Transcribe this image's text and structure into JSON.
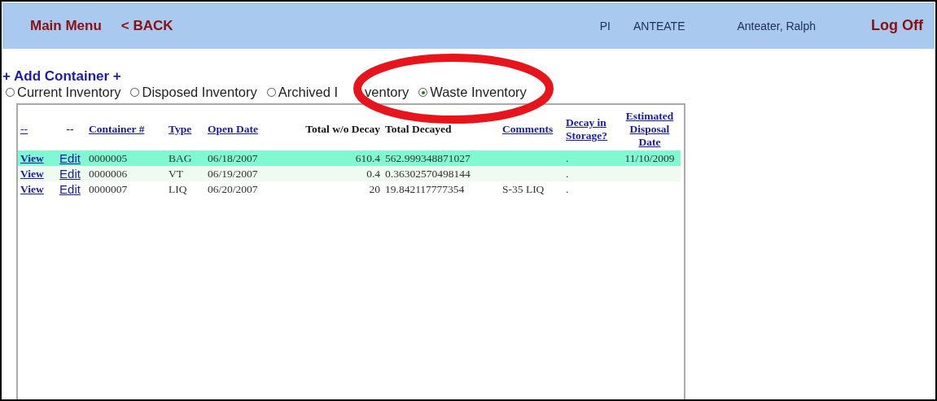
{
  "header": {
    "main_menu": "Main Menu",
    "back": "< BACK",
    "role": "PI",
    "user_id": "ANTEATE",
    "user_name": "Anteater, Ralph",
    "log_off": "Log Off"
  },
  "add_container": "+ Add Container +",
  "inventory_options": [
    {
      "label": "Current Inventory",
      "selected": false
    },
    {
      "label": "Disposed Inventory",
      "selected": false
    },
    {
      "label_parts": [
        "Archived I",
        "ventory"
      ],
      "selected": false
    },
    {
      "label": "Waste Inventory",
      "selected": true
    }
  ],
  "table": {
    "columns": [
      {
        "label": "--",
        "kind": "link"
      },
      {
        "label": "--",
        "kind": "text"
      },
      {
        "label": "Container #",
        "kind": "link"
      },
      {
        "label": "Type",
        "kind": "link"
      },
      {
        "label": "Open Date",
        "kind": "link"
      },
      {
        "label": "Total w/o Decay",
        "kind": "text"
      },
      {
        "label": "Total Decayed",
        "kind": "text"
      },
      {
        "label": "Comments",
        "kind": "link"
      },
      {
        "label": "Decay in Storage?",
        "kind": "link"
      },
      {
        "label": "Estimated Disposal Date",
        "kind": "link"
      }
    ],
    "rows": [
      {
        "selected": true,
        "cells": [
          "View",
          "Edit",
          "0000005",
          "BAG",
          "06/18/2007",
          "610.4",
          "562.999348871027",
          "",
          ".",
          "11/10/2009"
        ]
      },
      {
        "selected": false,
        "cells": [
          "View",
          "Edit",
          "0000006",
          "VT",
          "06/19/2007",
          "0.4",
          "0.36302570498144",
          "",
          ".",
          ""
        ]
      },
      {
        "selected": false,
        "cells": [
          "View",
          "Edit",
          "0000007",
          "LIQ",
          "06/20/2007",
          "20",
          "19.842117777354",
          "S-35 LIQ",
          ".",
          ""
        ]
      }
    ]
  }
}
